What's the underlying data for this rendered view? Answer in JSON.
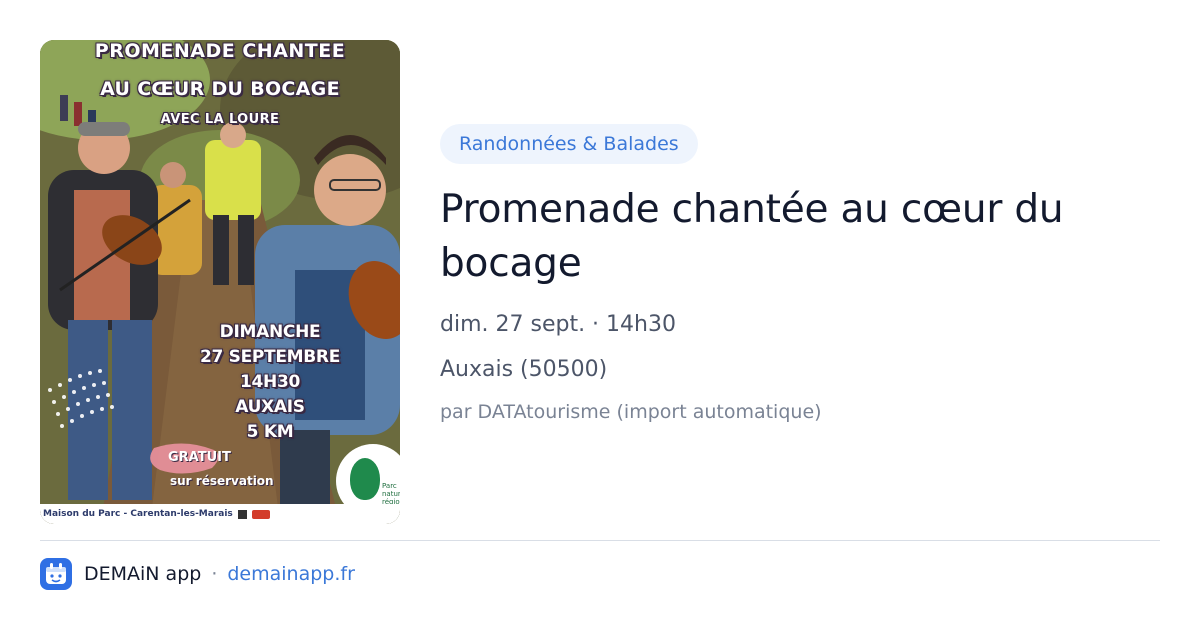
{
  "poster": {
    "title_line1": "PROMENADE CHANTEE",
    "title_line2": "AU CŒUR DU BOCAGE",
    "subtitle": "AVEC LA LOURE",
    "info_lines": [
      "DIMANCHE",
      "27 SEPTEMBRE",
      "14H30",
      "AUXAIS",
      "5 KM"
    ],
    "free_line1": "GRATUIT",
    "free_line2": "sur réservation",
    "footer_text": "Maison du Parc - Carentan-les-Marais",
    "park_text": "Parc naturel régional des Marais du"
  },
  "category": "Randonnées & Balades",
  "title": "Promenade chantée au cœur du bocage",
  "date": "dim. 27 sept. · 14h30",
  "location": "Auxais (50500)",
  "source": "par DATAtourisme (import automatique)",
  "footer": {
    "app_name": "DEMAiN app",
    "separator": "·",
    "domain": "demainapp.fr"
  },
  "colors": {
    "tag_bg": "#eef4fd",
    "accent": "#3b78d8",
    "app_icon": "#2f6fe4"
  },
  "icons": {
    "app": "demain-app-icon",
    "poster": "event-poster-image"
  }
}
